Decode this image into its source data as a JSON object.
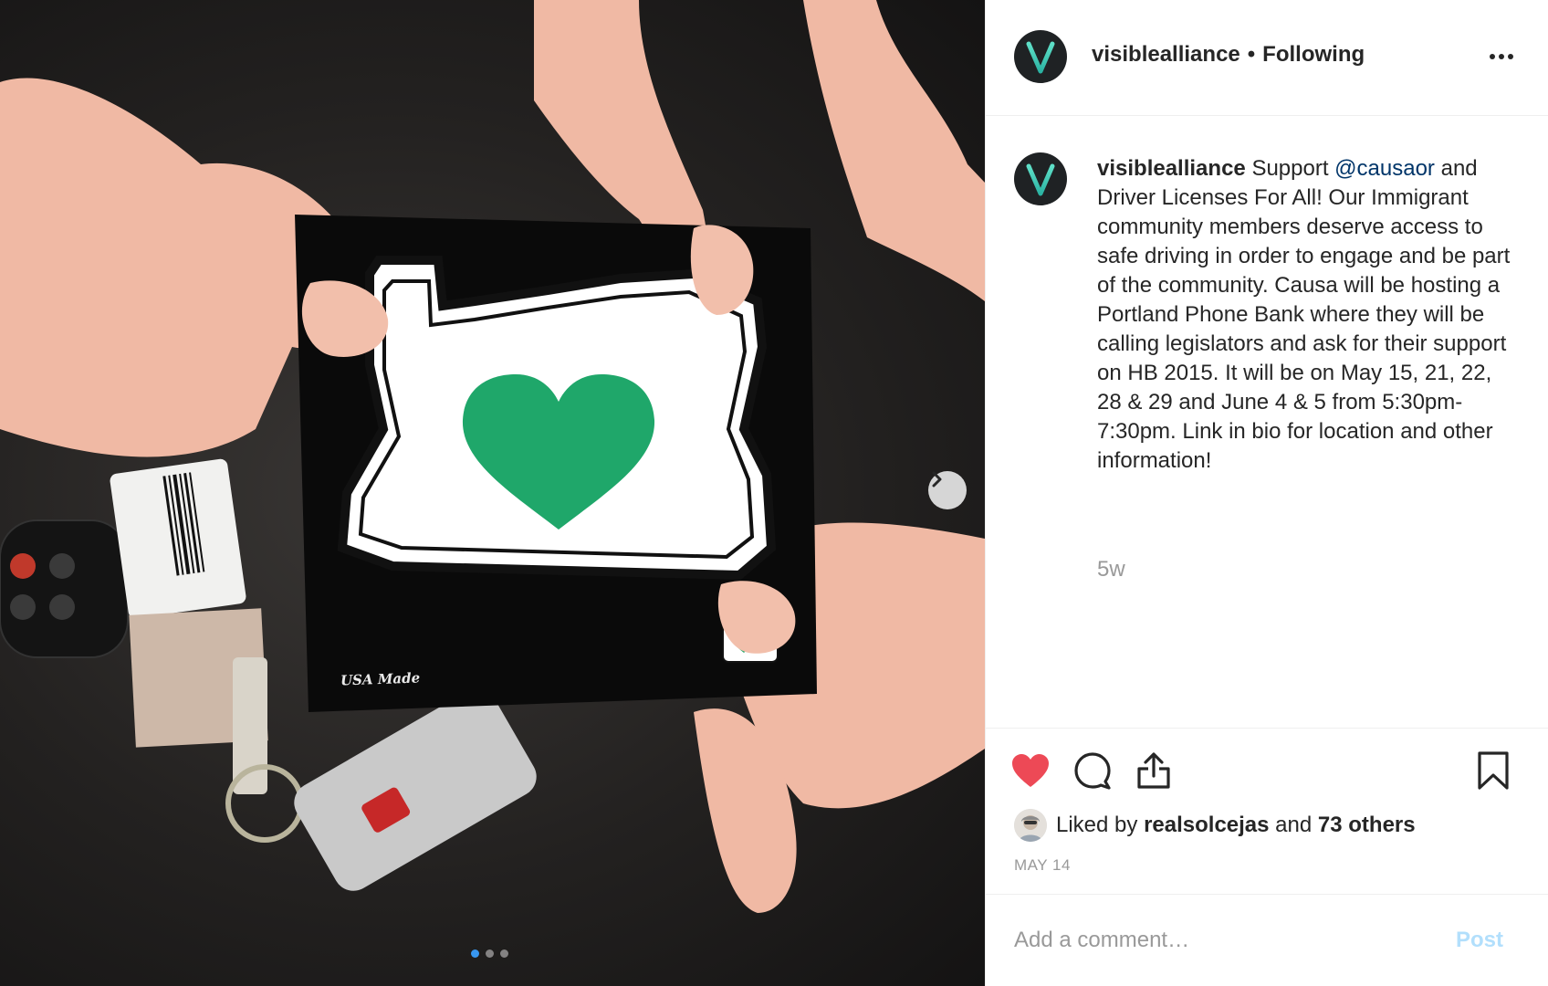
{
  "post": {
    "username": "visiblealliance",
    "separator": "•",
    "follow_status": "Following",
    "caption_username": "visiblealliance",
    "caption_prefix": "Support ",
    "caption_mention": "@causaor",
    "caption_rest": " and Driver Licenses For All! Our Immigrant community members deserve access to safe driving in order to engage and be part of the community. Causa will be hosting a Portland Phone Bank where they will be calling legislators and ask for their support on HB 2015. It will be on May 15, 21, 22, 28 & 29 and June 4 & 5 from 5:30pm-7:30pm. Link in bio for location and other information!",
    "time_ago": "5w",
    "liked_by_prefix": "Liked by ",
    "liked_by_user": "realsolcejas",
    "liked_by_middle": " and ",
    "liked_by_others": "73 others",
    "date": "MAY 14"
  },
  "comment": {
    "placeholder": "Add a comment…",
    "post_label": "Post"
  },
  "photo": {
    "sticker_text": "USA Made",
    "slide_count": 3,
    "active_slide": 1
  },
  "icons": {
    "avatar": "v-logo-icon",
    "more": "more-options-icon",
    "like": "heart-icon",
    "comment": "comment-icon",
    "share": "share-icon",
    "save": "bookmark-icon",
    "next": "chevron-right-icon"
  },
  "colors": {
    "like_active": "#ed4956",
    "mention": "#003569",
    "post_disabled": "#b2dffc",
    "heart_sticker": "#1fa76a",
    "logo_teal": "#4fd1c5"
  }
}
